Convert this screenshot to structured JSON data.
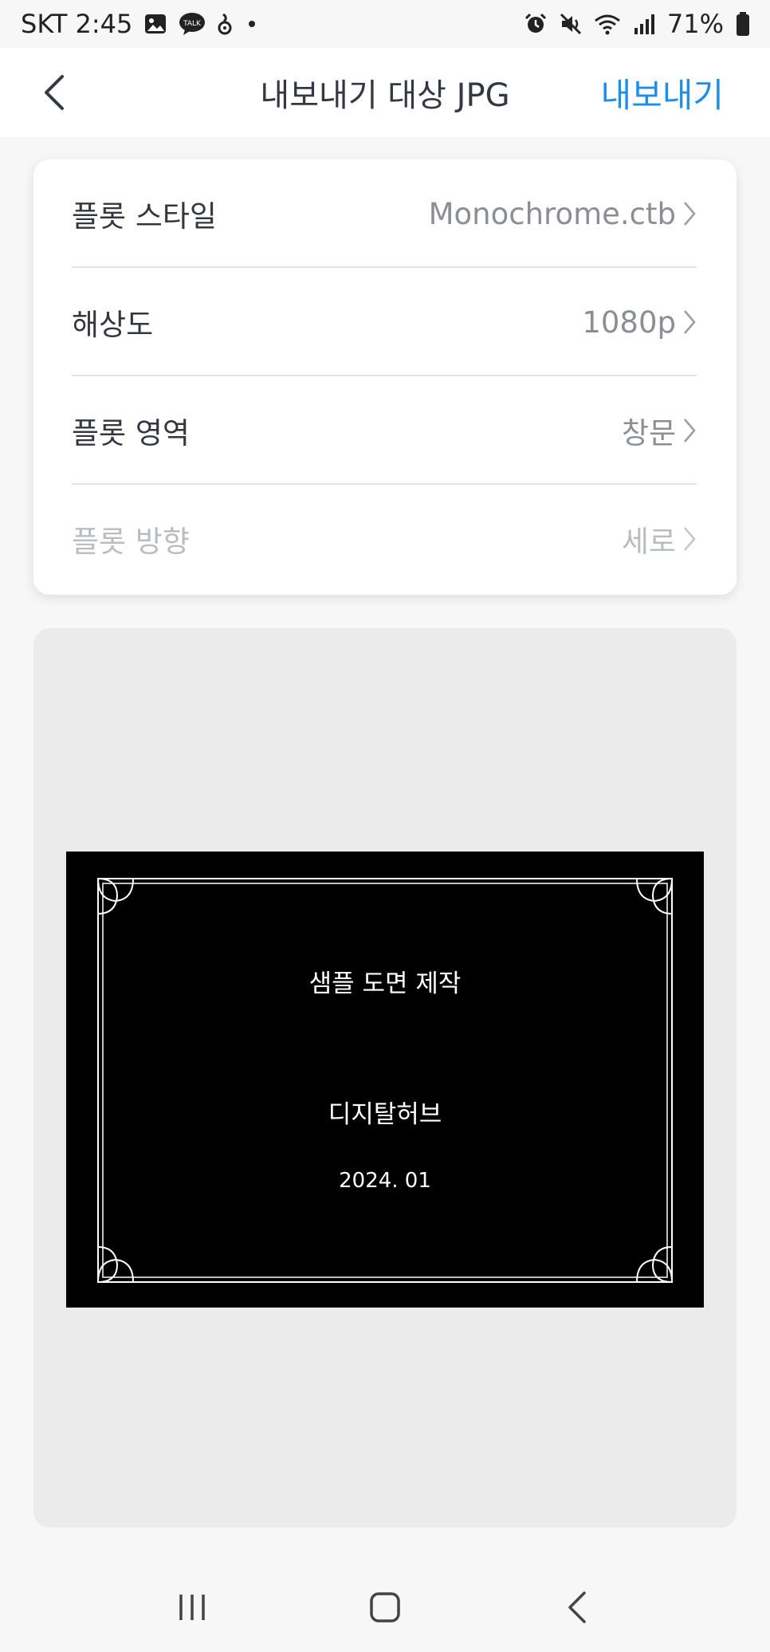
{
  "status_bar": {
    "carrier_time": "SKT 2:45",
    "battery": "71%",
    "icons_left": [
      "gallery-icon",
      "kakaotalk-icon",
      "notification-icon",
      "more-dot-icon"
    ],
    "icons_right": [
      "alarm-icon",
      "mute-icon",
      "wifi-icon",
      "signal-icon",
      "battery-icon"
    ]
  },
  "header": {
    "title": "내보내기 대상 JPG",
    "action_label": "내보내기",
    "accent_color": "#1e8fe6"
  },
  "settings": [
    {
      "label": "플롯 스타일",
      "value": "Monochrome.ctb",
      "enabled": true
    },
    {
      "label": "해상도",
      "value": "1080p",
      "enabled": true
    },
    {
      "label": "플롯 영역",
      "value": "창문",
      "enabled": true
    },
    {
      "label": "플롯 방향",
      "value": "세로",
      "enabled": false
    }
  ],
  "preview": {
    "title": "샘플 도면 제작",
    "company": "디지탈허브",
    "date": "2024. 01"
  },
  "nav": [
    "recent-apps-icon",
    "home-icon",
    "back-icon"
  ]
}
